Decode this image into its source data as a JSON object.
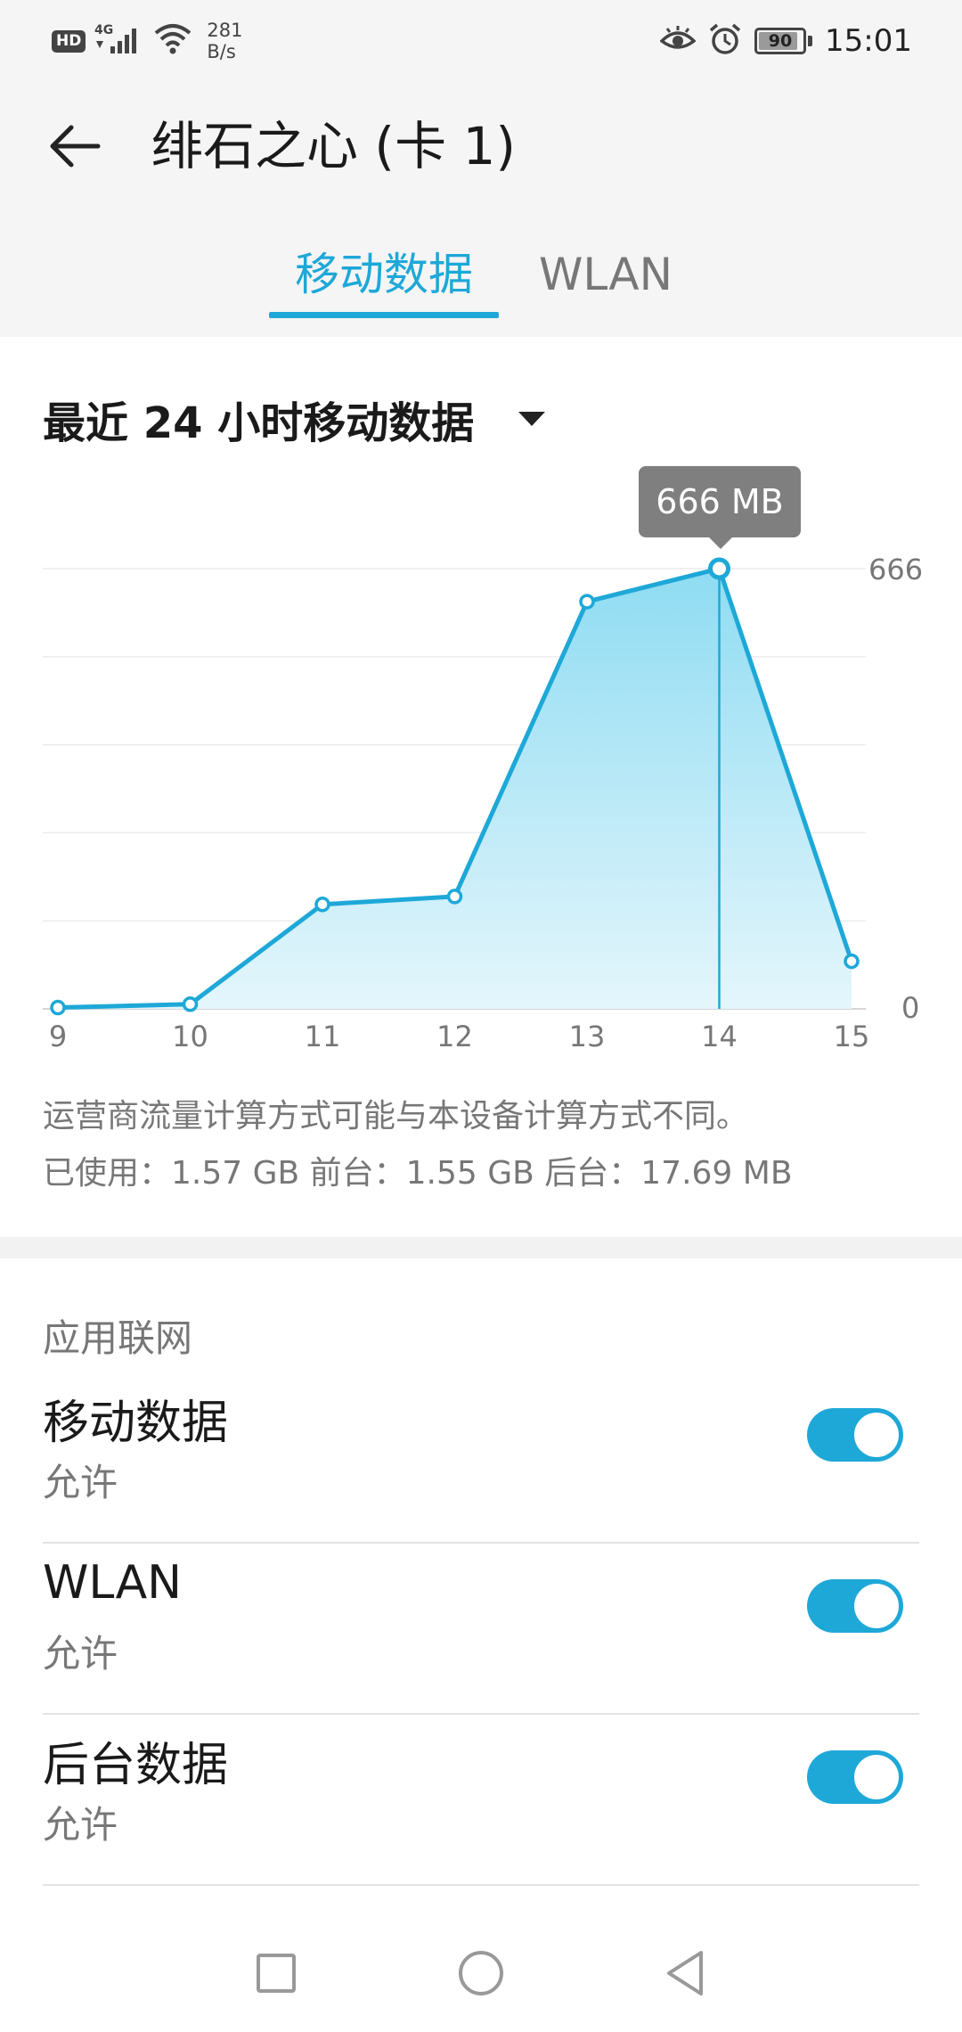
{
  "status_bar": {
    "hd": "HD",
    "network_type": "4G",
    "speed_value": "281",
    "speed_unit": "B/s",
    "battery": "90",
    "time": "15:01",
    "icons": [
      "signal-icon",
      "wifi-icon",
      "eye-icon",
      "alarm-icon",
      "battery-icon"
    ]
  },
  "header": {
    "back_icon": "back-arrow-icon",
    "title": "绯石之心 (卡 1)"
  },
  "tabs": [
    {
      "label": "移动数据",
      "active": true
    },
    {
      "label": "WLAN",
      "active": false
    }
  ],
  "period_selector": {
    "label": "最近 24 小时移动数据",
    "icon": "dropdown-triangle-icon"
  },
  "chart_data": {
    "type": "area",
    "x": [
      "9",
      "10",
      "11",
      "12",
      "13",
      "14",
      "15"
    ],
    "values": [
      2,
      7,
      158,
      170,
      616,
      666,
      72
    ],
    "ylim": [
      0,
      666
    ],
    "y_tick_labels": [
      "0",
      "666"
    ],
    "grid": true,
    "highlight": {
      "x": "14",
      "label": "666 MB"
    },
    "colors": {
      "line": "#1ea8d8",
      "fill_top": "#8fdcf2",
      "fill_bottom": "#e4f6fc"
    }
  },
  "note": "运营商流量计算方式可能与本设备计算方式不同。",
  "usage": "已使用：1.57 GB 前台：1.55 GB 后台：17.69 MB",
  "app_network": {
    "section_title": "应用联网",
    "items": [
      {
        "title": "移动数据",
        "subtitle": "允许",
        "enabled": true
      },
      {
        "title": "WLAN",
        "subtitle": "允许",
        "enabled": true
      },
      {
        "title": "后台数据",
        "subtitle": "允许",
        "enabled": true
      }
    ]
  },
  "nav_bar": {
    "icons": [
      "recent-apps-icon",
      "home-icon",
      "back-icon"
    ]
  },
  "colors": {
    "accent": "#1ea8d8",
    "header_bg": "#f5f5f5",
    "tooltip_bg": "#7f7f7f"
  }
}
